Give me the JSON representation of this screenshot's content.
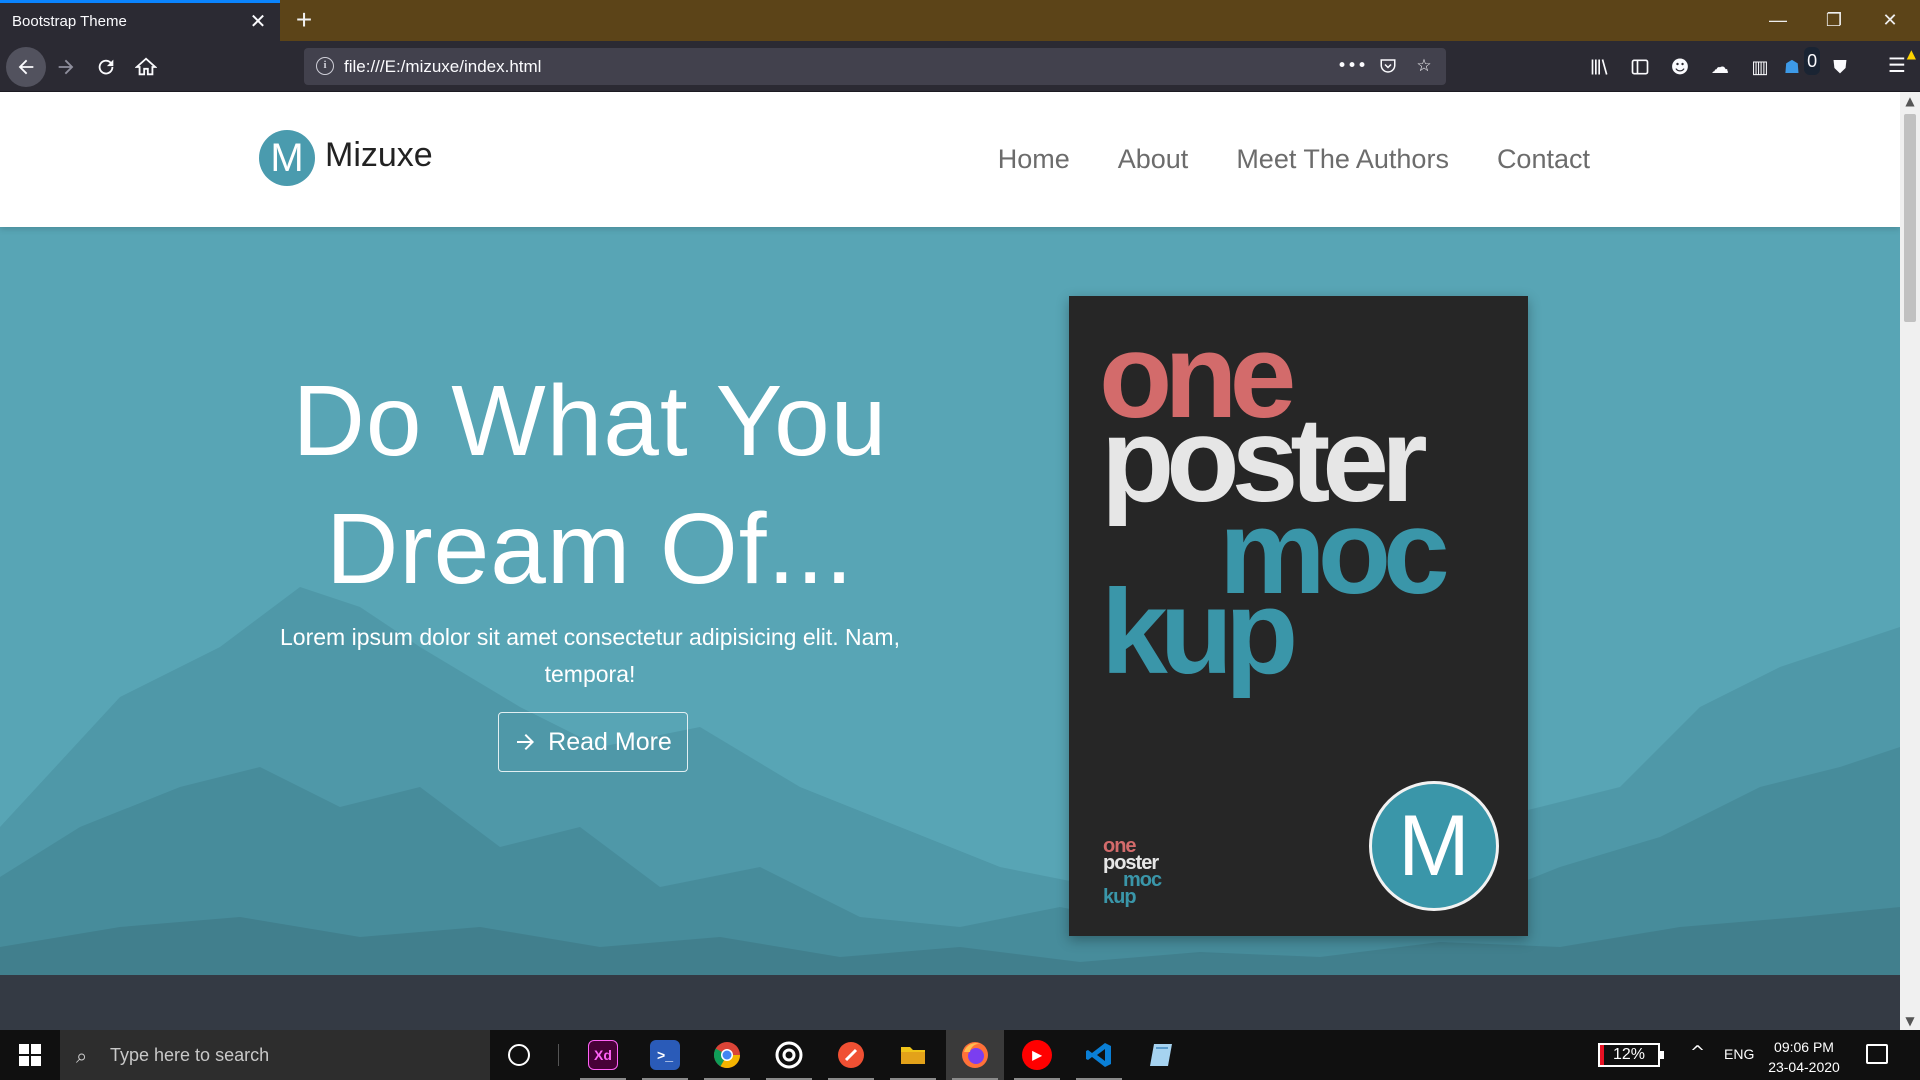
{
  "browser": {
    "tab_title": "Bootstrap Theme",
    "tab_close": "✕",
    "new_tab": "+",
    "window_controls": {
      "minimize": "—",
      "restore": "❐",
      "close": "✕"
    },
    "url": "file:///E:/mizuxe/index.html",
    "url_actions": {
      "more": "•••"
    },
    "toolbar_badge": "0"
  },
  "site": {
    "brand_letter": "M",
    "brand_name": "Mizuxe",
    "nav": [
      "Home",
      "About",
      "Meet The Authors",
      "Contact"
    ]
  },
  "hero": {
    "title_line1": "Do What You",
    "title_line2": "Dream Of...",
    "subtitle": "Lorem ipsum dolor sit amet consectetur adipisicing elit. Nam, tempora!",
    "button_label": "Read More",
    "button_icon": "arrow-right-icon",
    "colors": {
      "hero_bg": "#58a5b5",
      "dark_strip": "#343a44"
    }
  },
  "poster": {
    "words": [
      "one",
      "poster",
      "moc",
      "kup"
    ],
    "mini_words": [
      "one",
      "poster",
      "moc",
      "kup"
    ],
    "logo_letter": "M",
    "colors": {
      "one": "#d36b6b",
      "poster": "#e6e6e6",
      "mockup": "#3a96a9",
      "bg": "#262626"
    }
  },
  "taskbar": {
    "search_placeholder": "Type here to search",
    "apps": [
      {
        "name": "adobe-xd",
        "label": "Xd",
        "color": "#470137",
        "fg": "#ff61f6"
      },
      {
        "name": "powershell",
        "label": ">_",
        "color": "#2a5bb8",
        "fg": "#ffffff"
      },
      {
        "name": "chrome",
        "label": "",
        "color": "#ffffff",
        "fg": "#ffffff"
      },
      {
        "name": "media-app",
        "label": "",
        "color": "#101010",
        "fg": "#ffffff"
      },
      {
        "name": "git-app",
        "label": "",
        "color": "#f05033",
        "fg": "#ffffff"
      },
      {
        "name": "file-explorer",
        "label": "",
        "color": "#f0c419",
        "fg": "#ffffff"
      },
      {
        "name": "firefox",
        "label": "",
        "color": "#ff7139",
        "fg": "#ffffff"
      },
      {
        "name": "youtube-music",
        "label": "▶",
        "color": "#ff0000",
        "fg": "#ffffff"
      },
      {
        "name": "vscode",
        "label": "",
        "color": "#0078d4",
        "fg": "#ffffff"
      },
      {
        "name": "notepad-app",
        "label": "",
        "color": "#7fb8e0",
        "fg": "#ffffff"
      }
    ],
    "battery": "12%",
    "language": "ENG",
    "time": "09:06 PM",
    "date": "23-04-2020"
  }
}
